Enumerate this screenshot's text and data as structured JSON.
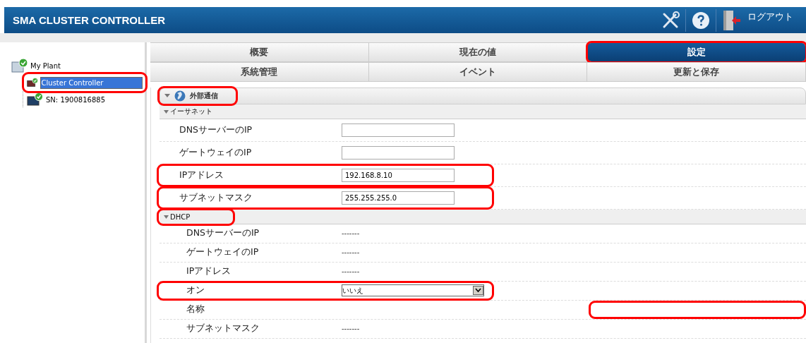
{
  "header": {
    "title": "SMA CLUSTER CONTROLLER",
    "logout": "ログアウト"
  },
  "tree": {
    "label": "My Plant",
    "highlighted": false,
    "children": [
      {
        "label": "Cluster Controller",
        "selected": true,
        "highlighted": true
      },
      {
        "label": "SN: 1900816885",
        "selected": false,
        "highlighted": false
      }
    ]
  },
  "tabs": [
    [
      {
        "label": "概要",
        "selected": false,
        "highlighted": false
      },
      {
        "label": "現在の値",
        "selected": false,
        "highlighted": false
      },
      {
        "label": "設定",
        "selected": true,
        "highlighted": true
      }
    ],
    [
      {
        "label": "系統管理",
        "selected": false,
        "highlighted": false
      },
      {
        "label": "イベント",
        "selected": false,
        "highlighted": false
      },
      {
        "label": "更新と保存",
        "selected": false,
        "highlighted": false
      }
    ]
  ],
  "section": {
    "title": "外部通信",
    "highlighted": true
  },
  "groups": [
    {
      "title": "イーサネット",
      "expanded": true,
      "highlighted": false,
      "rows": [
        {
          "label": "DNSサーバーのIP",
          "kind": "input",
          "highlighted": false
        },
        {
          "label": "ゲートウェイのIP",
          "kind": "input",
          "highlighted": false
        },
        {
          "label": "IPアドレス",
          "kind": "input",
          "value": "192.168.8.10",
          "highlighted": true
        },
        {
          "label": "サブネットマスク",
          "kind": "input",
          "value": "255.255.255.0",
          "highlighted": true
        }
      ]
    },
    {
      "title": "DHCP",
      "expanded": true,
      "highlighted": true,
      "rows": [
        {
          "label": "DNSサーバーのIP",
          "kind": "text",
          "value": "-------",
          "highlighted": false
        },
        {
          "label": "ゲートウェイのIP",
          "kind": "text",
          "value": "-------",
          "highlighted": false
        },
        {
          "label": "IPアドレス",
          "kind": "text",
          "value": "-------",
          "highlighted": false
        },
        {
          "label": "オン",
          "kind": "select",
          "value": "いいえ",
          "highlighted": true
        },
        {
          "label": "名称",
          "kind": "text",
          "highlighted": false,
          "value_highlighted": true
        },
        {
          "label": "サブネットマスク",
          "kind": "text",
          "value": "-------",
          "highlighted": false
        }
      ]
    }
  ]
}
